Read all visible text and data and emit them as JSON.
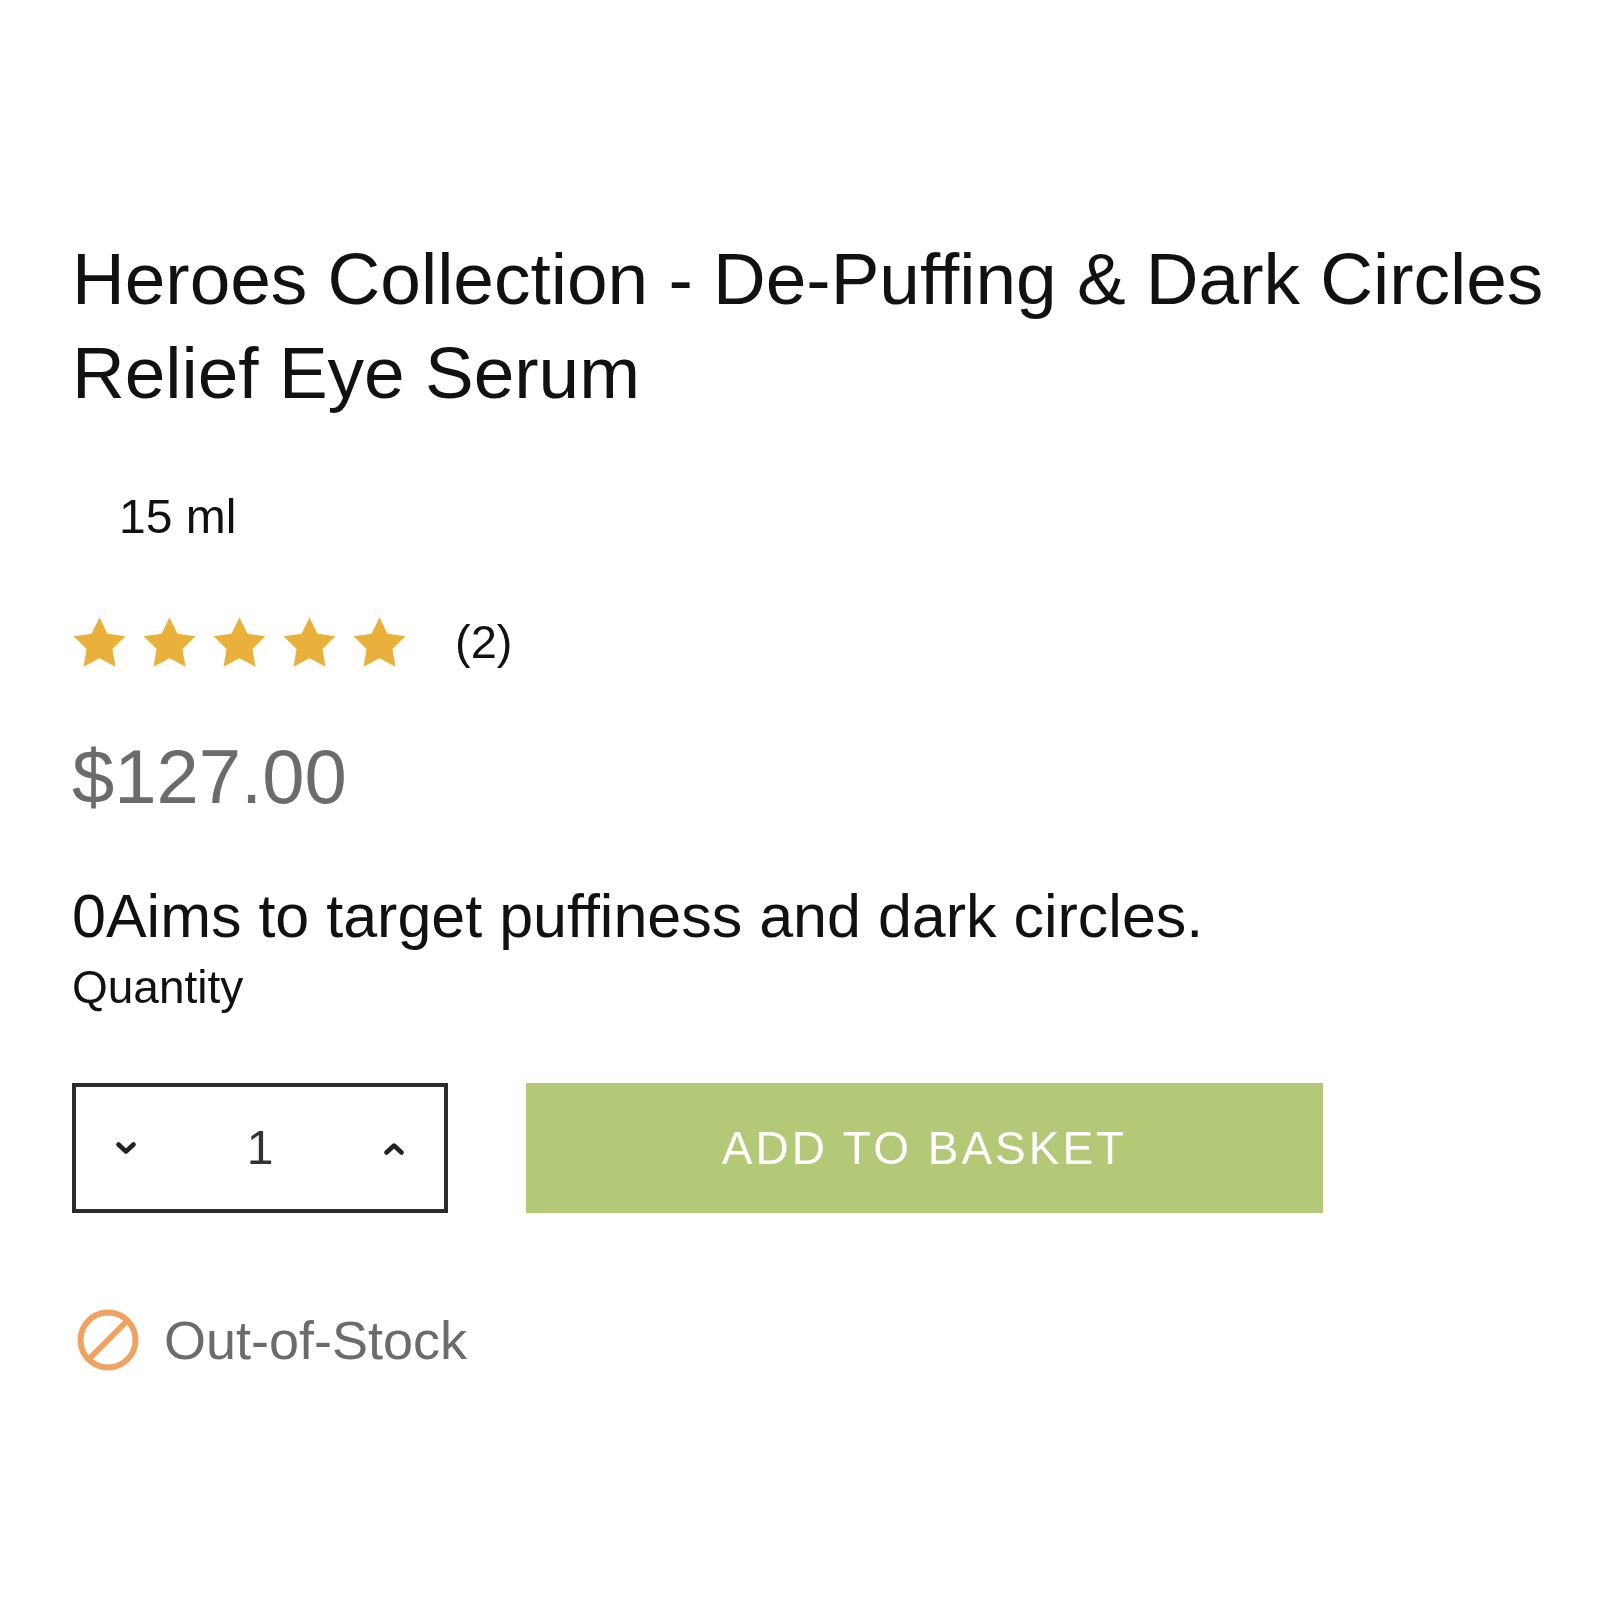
{
  "product": {
    "title": "Heroes Collection - De-Puffing & Dark Circles Relief Eye Serum",
    "size": "15 ml",
    "rating": {
      "stars": 5,
      "count": "(2)"
    },
    "price": "$127.00",
    "description": "0Aims to target puffiness and dark circles."
  },
  "quantity": {
    "label": "Quantity",
    "value": "1"
  },
  "add_button": {
    "label": "ADD TO BASKET"
  },
  "stock_status": {
    "kind": "out_of_stock",
    "label": "Out-of-Stock"
  }
}
